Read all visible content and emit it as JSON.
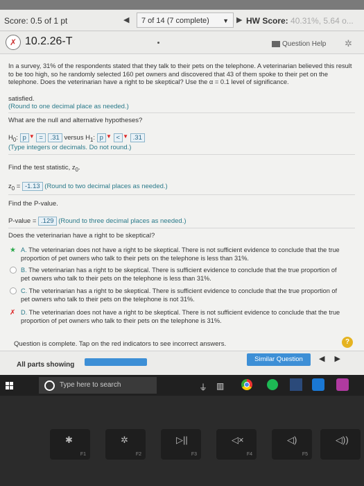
{
  "header": {
    "score": "Score: 0.5 of 1 pt",
    "question_count": "7 of 14 (7 complete)",
    "hw_score_label": "HW Score:",
    "hw_score_value": "40.31%, 5.64 o..."
  },
  "title": {
    "question_id": "10.2.26-T",
    "help_label": "Question Help"
  },
  "problem": {
    "text_1": "In a survey, 31% of the respondents stated that they talk to their pets on the telephone. A veterinarian believed this result to be too high, so he randomly selected 160 pet owners and discovered that 43 of them spoke to their pet on the telephone. Does the veterinarian have a right to be skeptical? Use the α = 0.1 level of significance.",
    "satisfied": "satisfied.",
    "round_note": "(Round to one decimal place as needed.)"
  },
  "hypotheses": {
    "prompt": "What are the null and alternative hypotheses?",
    "h0_label": "H",
    "h0_sub": "0",
    "p": "p",
    "eq": "=",
    "h0_value": ".31",
    "versus": "versus H",
    "h1_sub": "1",
    "lt": "<",
    "h1_value": ".31",
    "note": "(Type integers or decimals. Do not round.)"
  },
  "test_stat": {
    "prompt": "Find the test statistic, z",
    "prompt_sub": "0",
    "label": "z",
    "label_sub": "0",
    "value": "-1.13",
    "note": "(Round to two decimal places as needed.)"
  },
  "pvalue": {
    "prompt": "Find the P-value.",
    "label": "P-value =",
    "value": ".129",
    "note": "(Round to three decimal places as needed.)"
  },
  "skeptical": {
    "prompt": "Does the veterinarian have a right to be skeptical?",
    "options": [
      {
        "letter": "A.",
        "text": "The veterinarian does not have a right to be skeptical. There is not sufficient evidence to conclude that the true proportion of pet owners who talk to their pets on the telephone is less than 31%."
      },
      {
        "letter": "B.",
        "text": "The veterinarian has a right to be skeptical. There is sufficient evidence to conclude that the true proportion of pet owners who talk to their pets on the telephone is less than 31%."
      },
      {
        "letter": "C.",
        "text": "The veterinarian has a right to be skeptical. There is sufficient evidence to conclude that the true proportion of pet owners who talk to their pets on the telephone is not 31%."
      },
      {
        "letter": "D.",
        "text": "The veterinarian does not have a right to be skeptical. There is not sufficient evidence to conclude that the true proportion of pet owners who talk to their pets on the telephone is 31%."
      }
    ]
  },
  "footer": {
    "complete_msg": "Question is complete. Tap on the red indicators to see incorrect answers.",
    "all_parts": "All parts showing",
    "similar_question": "Similar Question",
    "help_mark": "?"
  },
  "taskbar": {
    "search_placeholder": "Type here to search"
  },
  "keys": [
    {
      "glyph": "✱",
      "fn": "F1"
    },
    {
      "glyph": "✲",
      "fn": "F2"
    },
    {
      "glyph": "▷||",
      "fn": "F3"
    },
    {
      "glyph": "◁×",
      "fn": "F4"
    },
    {
      "glyph": "◁)",
      "fn": "F5"
    },
    {
      "glyph": "◁))",
      "fn": ""
    }
  ],
  "colors": {
    "accent": "#3d8fd6",
    "correct_star": "#2aa84a",
    "incorrect_x": "#d22222"
  }
}
